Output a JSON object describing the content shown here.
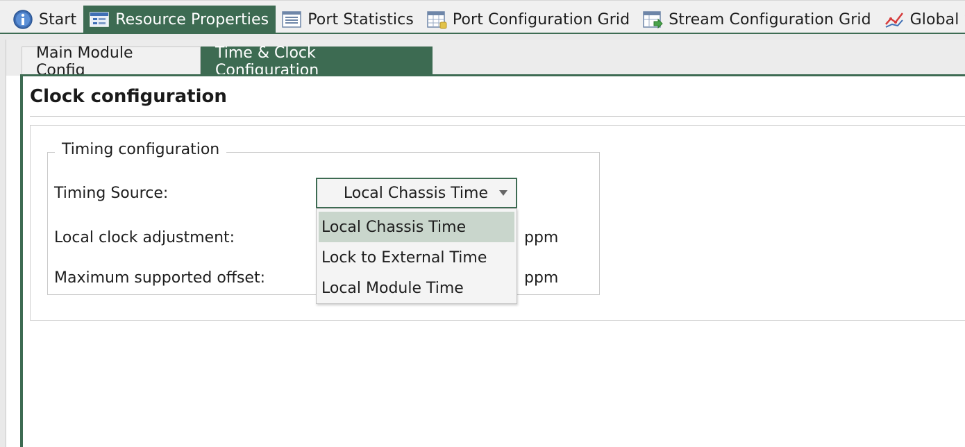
{
  "doc_tabs": [
    {
      "label": "Start",
      "icon": "info-icon"
    },
    {
      "label": "Resource Properties",
      "icon": "properties-icon"
    },
    {
      "label": "Port Statistics",
      "icon": "list-icon"
    },
    {
      "label": "Port Configuration Grid",
      "icon": "grid-icon"
    },
    {
      "label": "Stream Configuration Grid",
      "icon": "stream-grid-icon"
    },
    {
      "label": "Global Stati",
      "icon": "line-chart-icon"
    }
  ],
  "sub_tabs": [
    {
      "label": "Main Module Config"
    },
    {
      "label": "Time & Clock Configuration"
    }
  ],
  "panel": {
    "title": "Clock configuration",
    "group_title": "Timing configuration",
    "timing_source_label": "Timing Source:",
    "local_clock_label": "Local clock adjustment:",
    "max_offset_label": "Maximum supported offset:",
    "unit_ppm": "ppm"
  },
  "select": {
    "value": "Local Chassis Time",
    "options": [
      "Local Chassis Time",
      "Lock to External Time",
      "Local Module Time"
    ]
  },
  "colors": {
    "accent": "#3d6b52",
    "selected_option": "#c9d6cc"
  }
}
